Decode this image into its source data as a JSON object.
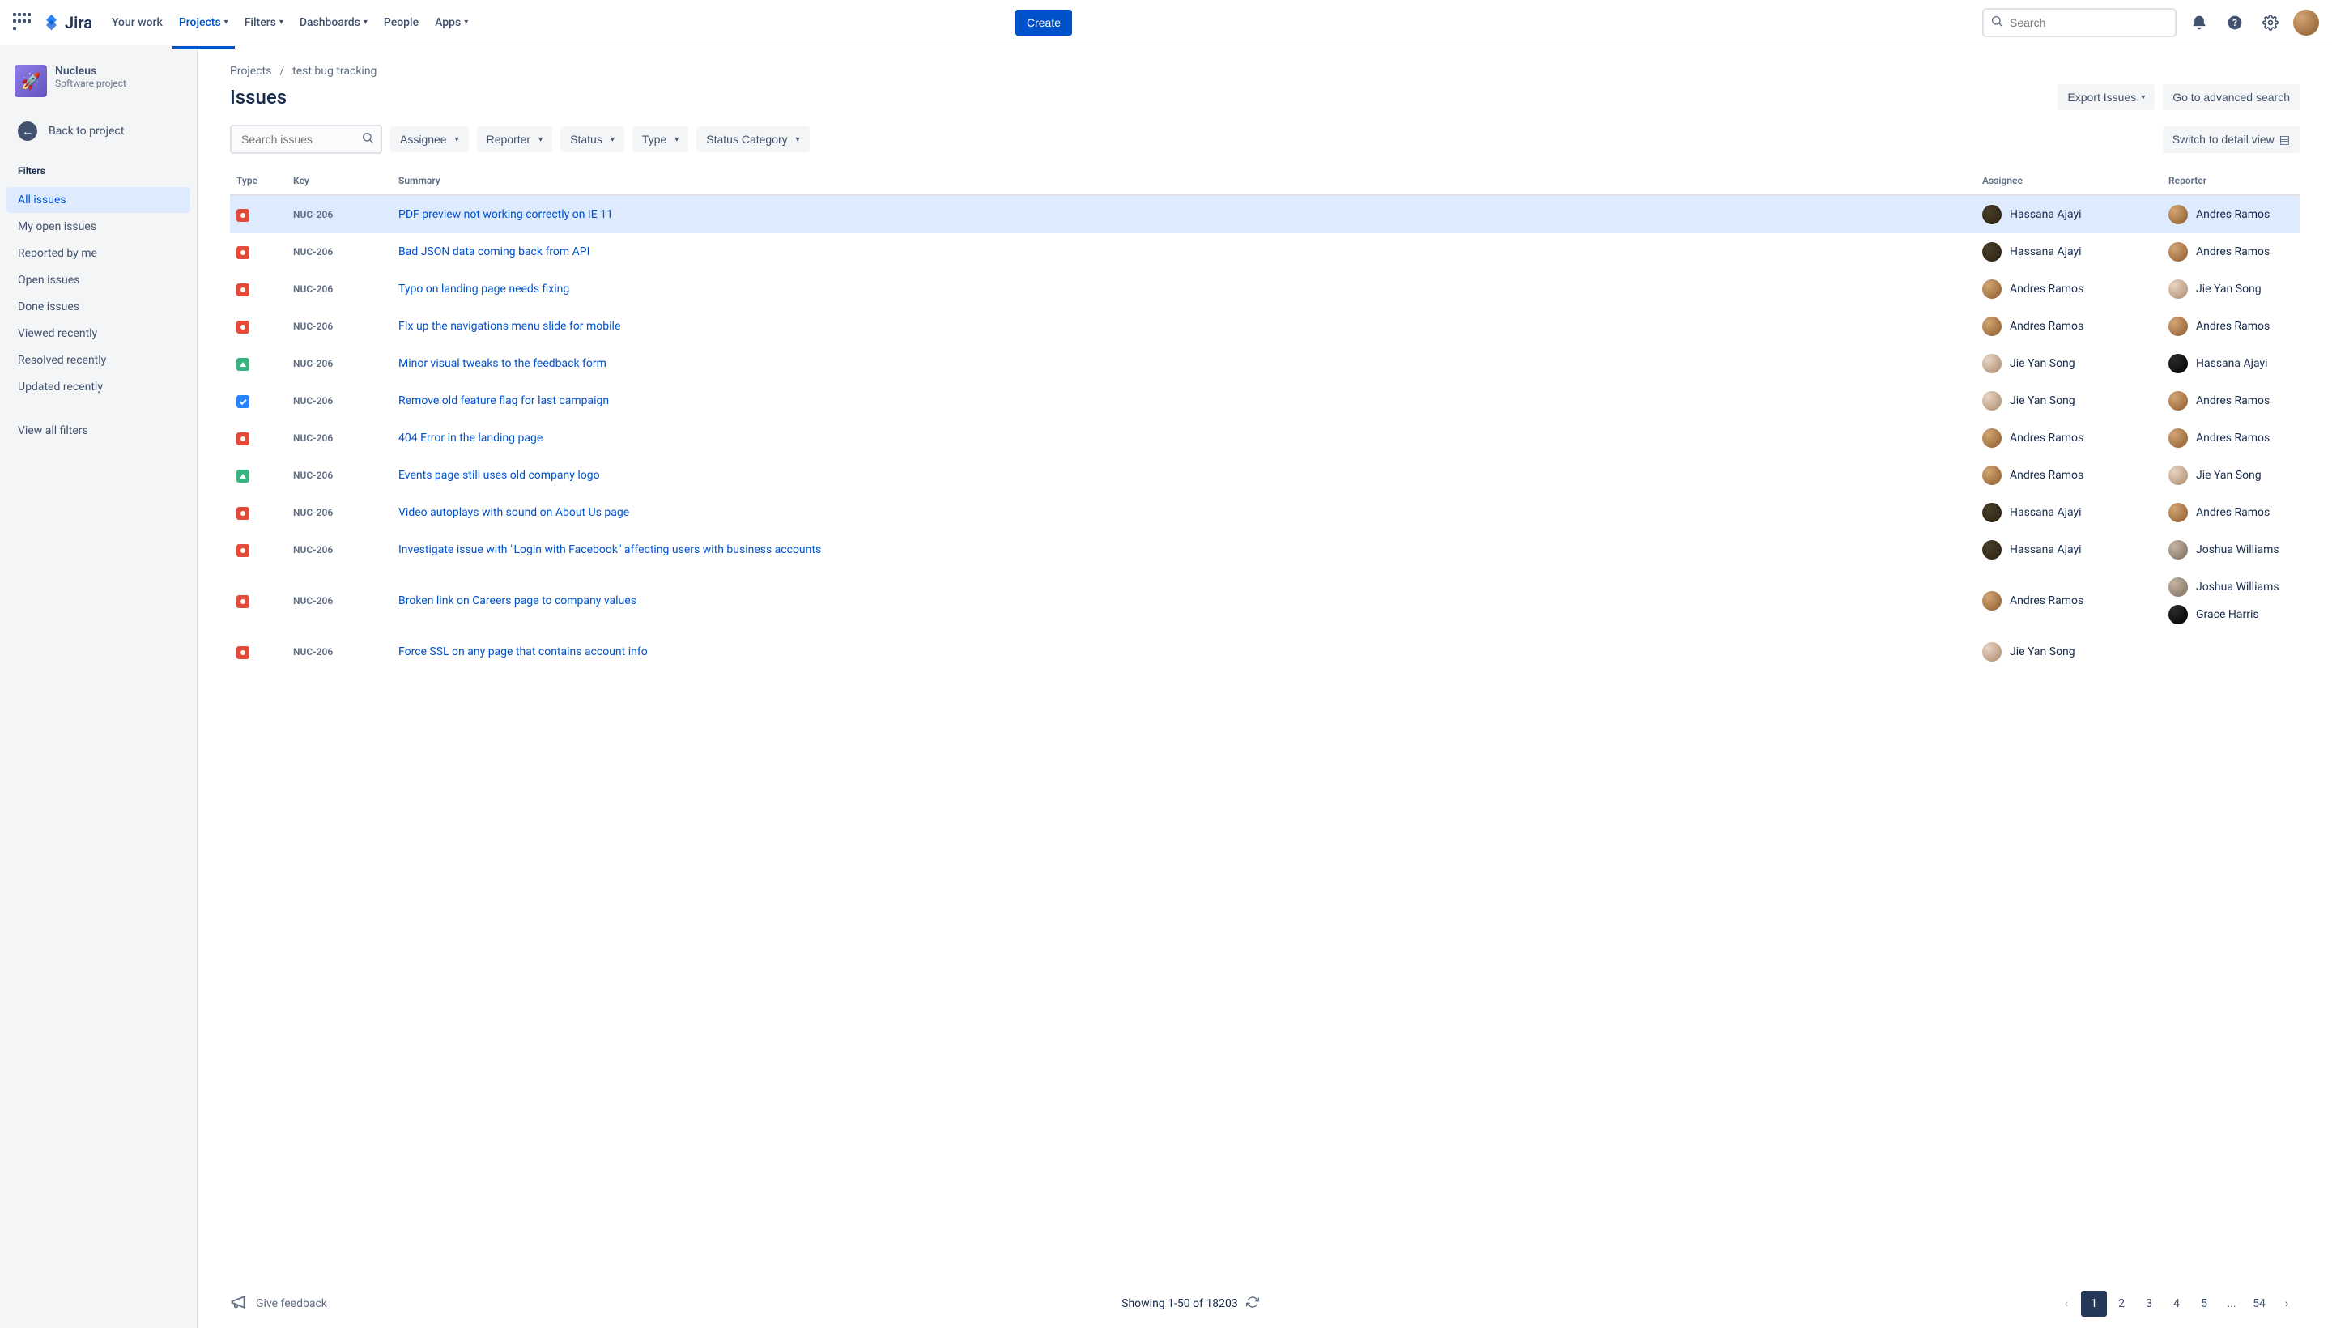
{
  "app": {
    "name": "Jira"
  },
  "topnav": {
    "items": [
      {
        "label": "Your work",
        "active": false,
        "chev": false
      },
      {
        "label": "Projects",
        "active": true,
        "chev": true
      },
      {
        "label": "Filters",
        "active": false,
        "chev": true
      },
      {
        "label": "Dashboards",
        "active": false,
        "chev": true
      },
      {
        "label": "People",
        "active": false,
        "chev": false
      },
      {
        "label": "Apps",
        "active": false,
        "chev": true
      }
    ],
    "create": "Create",
    "search_placeholder": "Search"
  },
  "sidebar": {
    "project_name": "Nucleus",
    "project_type": "Software project",
    "back": "Back to project",
    "section": "Filters",
    "filters": [
      {
        "label": "All issues",
        "active": true
      },
      {
        "label": "My open issues",
        "active": false
      },
      {
        "label": "Reported by me",
        "active": false
      },
      {
        "label": "Open issues",
        "active": false
      },
      {
        "label": "Done issues",
        "active": false
      },
      {
        "label": "Viewed recently",
        "active": false
      },
      {
        "label": "Resolved recently",
        "active": false
      },
      {
        "label": "Updated recently",
        "active": false
      }
    ],
    "view_all": "View all filters"
  },
  "breadcrumb": {
    "root": "Projects",
    "project": "test bug tracking"
  },
  "page": {
    "title": "Issues",
    "export": "Export Issues",
    "advanced": "Go to advanced search"
  },
  "toolbar": {
    "search_placeholder": "Search issues",
    "filters": [
      {
        "label": "Assignee"
      },
      {
        "label": "Reporter"
      },
      {
        "label": "Status"
      },
      {
        "label": "Type"
      },
      {
        "label": "Status Category"
      }
    ],
    "switch_view": "Switch to detail view"
  },
  "columns": {
    "type": "Type",
    "key": "Key",
    "summary": "Summary",
    "assignee": "Assignee",
    "reporter": "Reporter"
  },
  "issues": [
    {
      "type": "bug",
      "key": "NUC-206",
      "summary": "PDF preview not working correctly on IE 11",
      "assignee": "Hassana Ajayi",
      "assignee_av": "av1",
      "reporter": "Andres Ramos",
      "reporter_av": "av2",
      "selected": true
    },
    {
      "type": "bug",
      "key": "NUC-206",
      "summary": "Bad JSON data coming back from API",
      "assignee": "Hassana Ajayi",
      "assignee_av": "av1",
      "reporter": "Andres Ramos",
      "reporter_av": "av2"
    },
    {
      "type": "bug",
      "key": "NUC-206",
      "summary": "Typo on landing page needs fixing",
      "assignee": "Andres Ramos",
      "assignee_av": "av2",
      "reporter": "Jie Yan Song",
      "reporter_av": "av3"
    },
    {
      "type": "bug",
      "key": "NUC-206",
      "summary": "FIx up the navigations menu slide for mobile",
      "assignee": "Andres Ramos",
      "assignee_av": "av2",
      "reporter": "Andres Ramos",
      "reporter_av": "av2"
    },
    {
      "type": "improve",
      "key": "NUC-206",
      "summary": "Minor visual tweaks to the feedback form",
      "assignee": "Jie Yan Song",
      "assignee_av": "av3",
      "reporter": "Hassana Ajayi",
      "reporter_av": "av4"
    },
    {
      "type": "task",
      "key": "NUC-206",
      "summary": "Remove old feature flag for last campaign",
      "assignee": "Jie Yan Song",
      "assignee_av": "av3",
      "reporter": "Andres Ramos",
      "reporter_av": "av2"
    },
    {
      "type": "bug",
      "key": "NUC-206",
      "summary": "404 Error in the landing page",
      "assignee": "Andres Ramos",
      "assignee_av": "av2",
      "reporter": "Andres Ramos",
      "reporter_av": "av2"
    },
    {
      "type": "improve",
      "key": "NUC-206",
      "summary": "Events page still uses old company logo",
      "assignee": "Andres Ramos",
      "assignee_av": "av2",
      "reporter": "Jie Yan Song",
      "reporter_av": "av3"
    },
    {
      "type": "bug",
      "key": "NUC-206",
      "summary": "Video autoplays with sound on About Us page",
      "assignee": "Hassana Ajayi",
      "assignee_av": "av1",
      "reporter": "Andres Ramos",
      "reporter_av": "av2"
    },
    {
      "type": "bug",
      "key": "NUC-206",
      "summary": "Investigate issue with \"Login with Facebook\" affecting users with business accounts",
      "assignee": "Hassana Ajayi",
      "assignee_av": "av1",
      "reporter": "Joshua Williams",
      "reporter_av": "av5"
    },
    {
      "type": "bug",
      "key": "NUC-206",
      "summary": "Broken link on Careers page to company values",
      "assignee": "Andres Ramos",
      "assignee_av": "av2",
      "reporter": "Joshua Williams",
      "reporter_av": "av5",
      "extra_reporter": "Grace Harris",
      "extra_reporter_av": "av4"
    },
    {
      "type": "bug",
      "key": "NUC-206",
      "summary": "Force SSL on any page that contains account info",
      "assignee": "Jie Yan Song",
      "assignee_av": "av3",
      "reporter": "",
      "reporter_av": ""
    }
  ],
  "footer": {
    "feedback": "Give feedback",
    "showing": "Showing 1-50 of 18203",
    "pages": [
      "1",
      "2",
      "3",
      "4",
      "5",
      "...",
      "54"
    ]
  }
}
